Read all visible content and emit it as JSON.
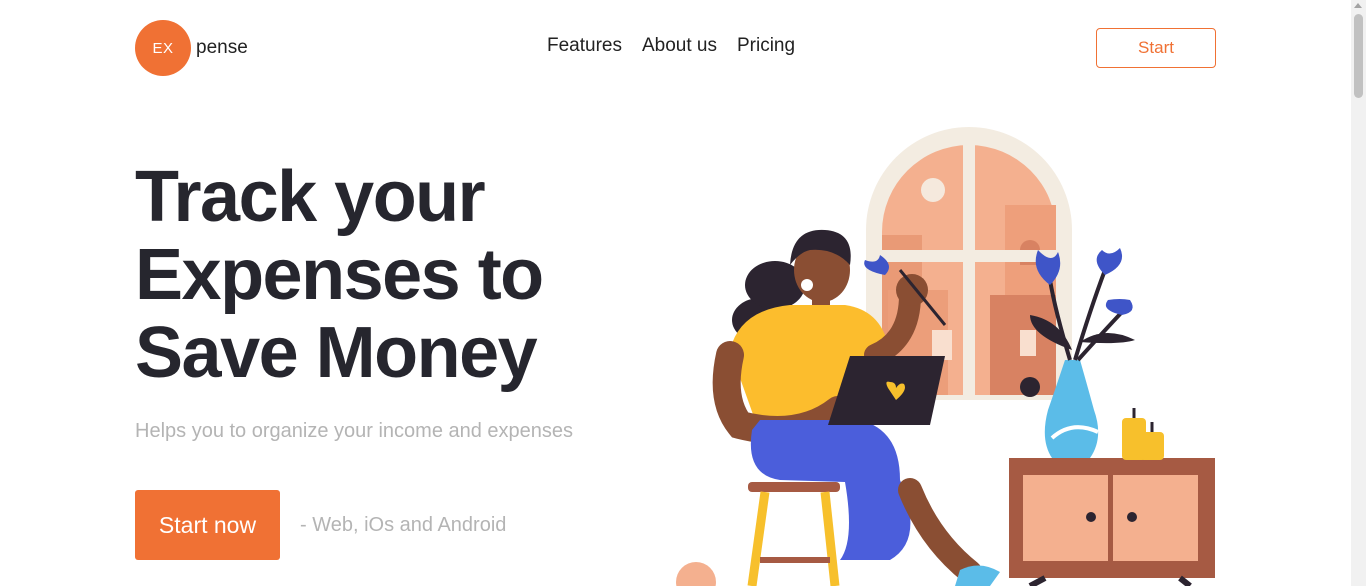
{
  "header": {
    "logo_mark": "EX",
    "logo_text": "pense",
    "nav": [
      {
        "label": "Features"
      },
      {
        "label": "About us"
      },
      {
        "label": "Pricing"
      }
    ],
    "start_label": "Start"
  },
  "hero": {
    "title_lines": [
      "Track your",
      "Expenses to",
      "Save Money"
    ],
    "subtitle": "Helps you to organize your income and expenses",
    "cta_label": "Start now",
    "platforms": "- Web, iOs and Android"
  },
  "illustration": {
    "description_icon": "woman-with-laptop-illustration"
  },
  "colors": {
    "accent": "#f07134",
    "heading": "#26262e",
    "muted": "#b4b4b4"
  }
}
